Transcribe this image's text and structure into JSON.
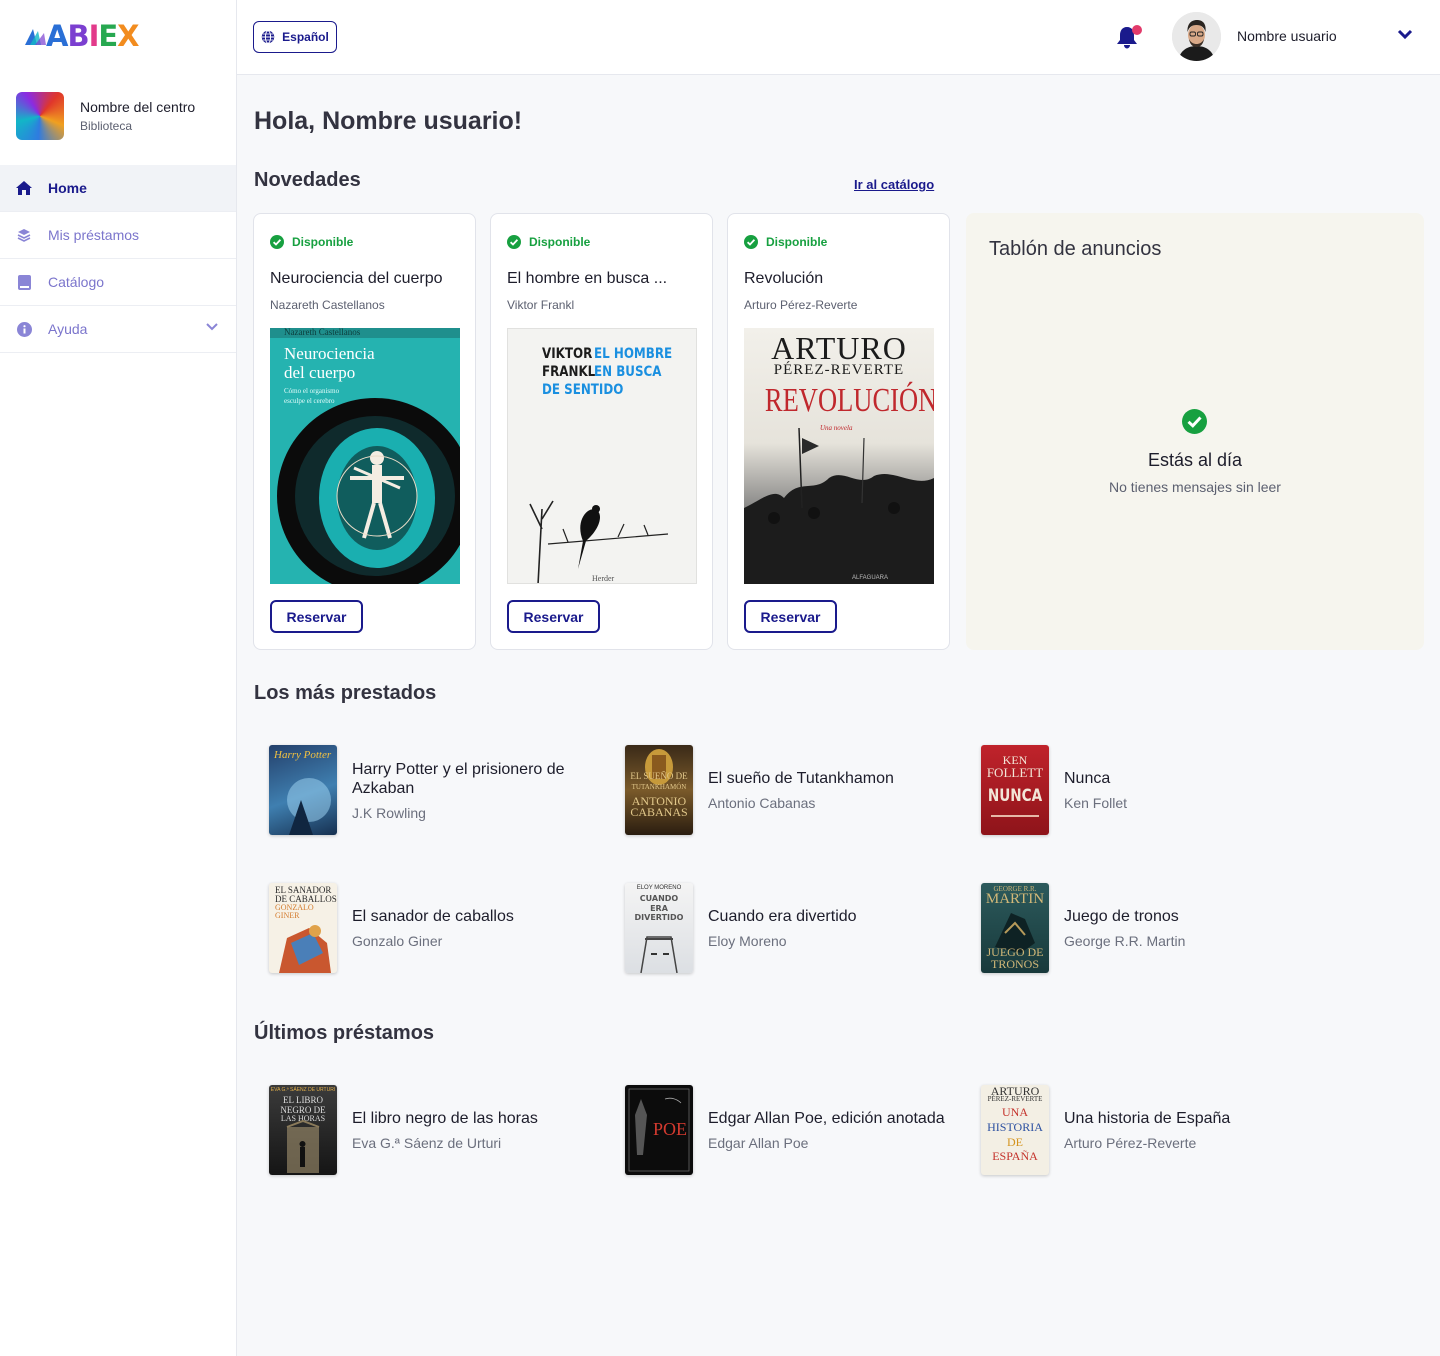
{
  "app": {
    "logo_text": [
      "A",
      "B",
      "I",
      "E",
      "X"
    ],
    "colors": {
      "primary": "#1a1a8c",
      "available": "#17a040",
      "notification_dot": "#e23a6a"
    }
  },
  "sidebar": {
    "center_name": "Nombre del centro",
    "center_type": "Biblioteca",
    "items": [
      {
        "label": "Home",
        "icon": "home-icon",
        "active": true
      },
      {
        "label": "Mis préstamos",
        "icon": "layers-icon"
      },
      {
        "label": "Catálogo",
        "icon": "book-icon"
      },
      {
        "label": "Ayuda",
        "icon": "info-icon",
        "expandable": true
      }
    ]
  },
  "topbar": {
    "language": "Español",
    "user_name": "Nombre usuario"
  },
  "main": {
    "greeting": "Hola, Nombre usuario!",
    "novedades": {
      "title": "Novedades",
      "catalog_link": "Ir al catálogo",
      "books": [
        {
          "status": "Disponible",
          "title": "Neurociencia del cuerpo",
          "author": "Nazareth Castellanos",
          "cover_lines": [
            "Neurociencia",
            "del cuerpo"
          ],
          "cover_header": "Nazareth Castellanos",
          "cover_sub": [
            "Cómo el organismo",
            "esculpe el cerebro"
          ],
          "action": "Reservar"
        },
        {
          "status": "Disponible",
          "title": "El hombre en busca ...",
          "author": "Viktor Frankl",
          "cover_left": [
            "VIKTOR",
            "FRANKL"
          ],
          "cover_right": [
            "EL HOMBRE",
            "EN BUSCA",
            "DE SENTIDO"
          ],
          "cover_footer": "Herder",
          "action": "Reservar"
        },
        {
          "status": "Disponible",
          "title": "Revolución",
          "author": "Arturo Pérez-Reverte",
          "cover_lines": [
            "ARTURO",
            "PÉREZ-REVERTE",
            "REVOLUCIÓN"
          ],
          "cover_sub": "Una novela",
          "cover_footer": "ALFAGUARA",
          "action": "Reservar"
        }
      ]
    },
    "board": {
      "title": "Tablón de anuncios",
      "status": "Estás al día",
      "message": "No tienes mensajes sin leer"
    },
    "most_borrowed": {
      "title": "Los más prestados",
      "items": [
        {
          "title": "Harry Potter y el prisionero de Azkaban",
          "author": "J.K Rowling"
        },
        {
          "title": "El sueño de Tutankhamon",
          "author": "Antonio Cabanas"
        },
        {
          "title": "Nunca",
          "author": "Ken Follet"
        },
        {
          "title": "El sanador de caballos",
          "author": "Gonzalo Giner"
        },
        {
          "title": "Cuando era divertido",
          "author": "Eloy Moreno"
        },
        {
          "title": "Juego de tronos",
          "author": "George R.R. Martin"
        }
      ]
    },
    "recent_loans": {
      "title": "Últimos préstamos",
      "items": [
        {
          "title": "El libro negro de las horas",
          "author": "Eva G.ª Sáenz de Urturi"
        },
        {
          "title": "Edgar Allan Poe, edición anotada",
          "author": "Edgar Allan Poe"
        },
        {
          "title": "Una historia de España",
          "author": "Arturo Pérez-Reverte"
        }
      ]
    }
  }
}
